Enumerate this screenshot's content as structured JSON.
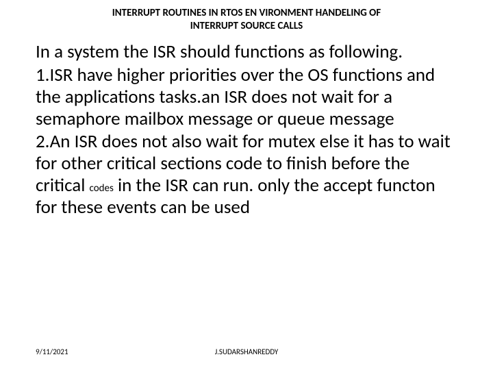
{
  "title": {
    "line1": "INTERRUPT ROUTINES IN RTOS EN VIRONMENT HANDELING OF",
    "line2": "INTERRUPT SOURCE CALLS"
  },
  "body": {
    "p1": "In a system the ISR should functions as following.",
    "p2": "1.ISR have higher priorities over the OS functions and the applications tasks.an ISR does not wait for a semaphore mailbox message or queue message",
    "p3a": "2.An ISR does not also wait for mutex  else it has to wait for other critical sections code to finish before the critical ",
    "p3_small": "codes",
    "p3b": " in the ISR can run. only the accept functon  for these events can be used"
  },
  "footer": {
    "date": "9/11/2021",
    "author": "J.SUDARSHANREDDY"
  }
}
